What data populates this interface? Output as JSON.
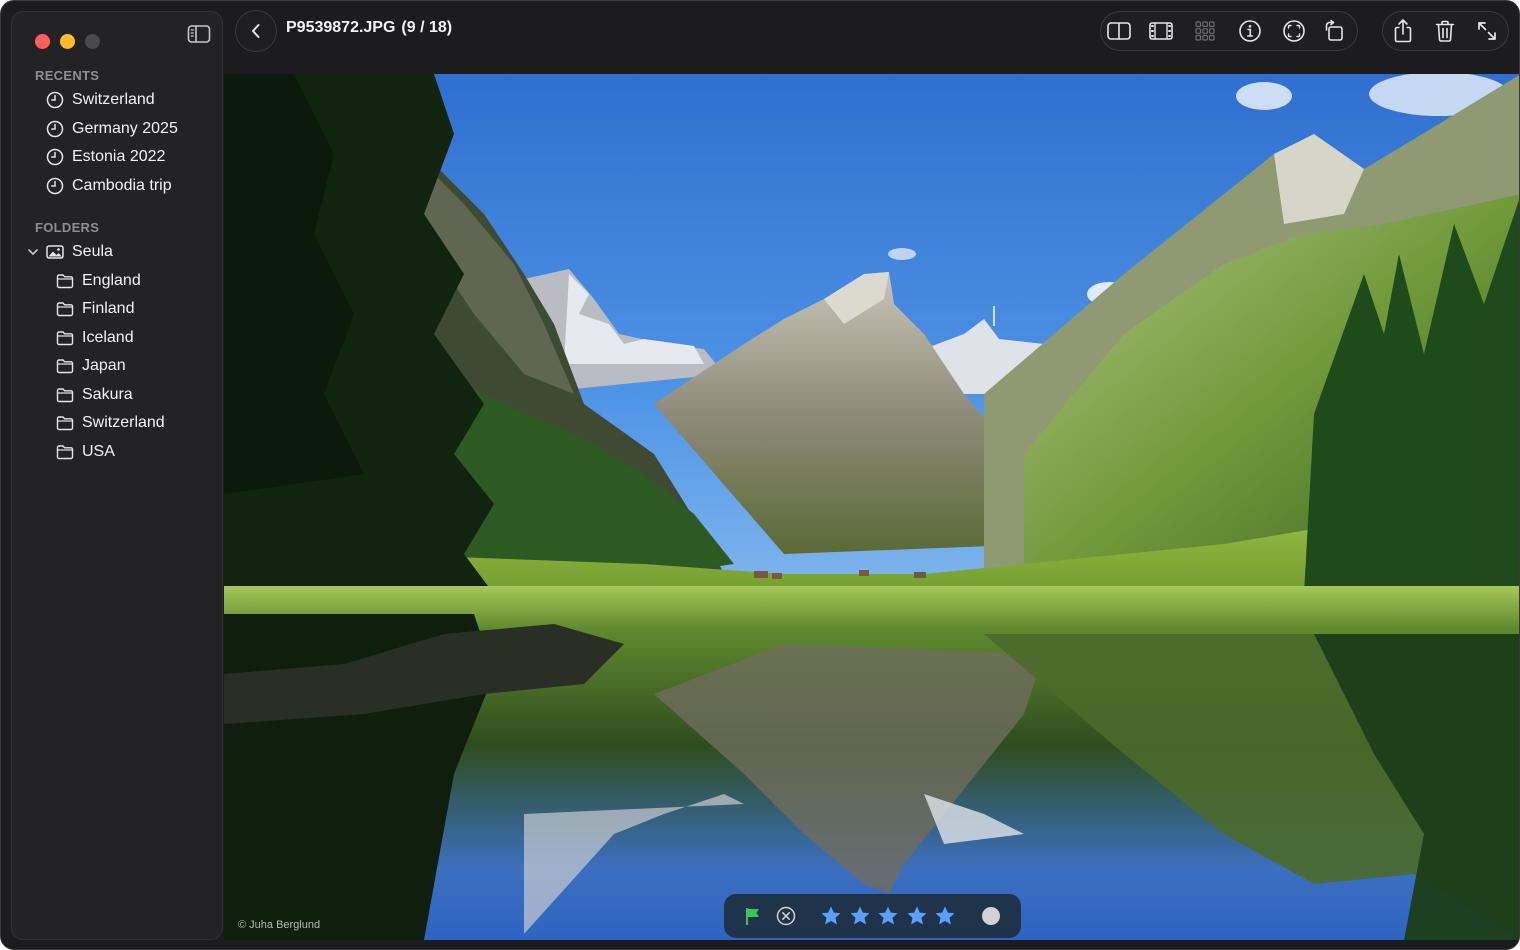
{
  "window": {
    "controls": [
      "close",
      "minimize",
      "zoom"
    ]
  },
  "sidebar": {
    "recents_title": "RECENTS",
    "recents": [
      {
        "label": "Switzerland",
        "icon": "clock-icon"
      },
      {
        "label": "Germany 2025",
        "icon": "clock-icon"
      },
      {
        "label": "Estonia 2022",
        "icon": "clock-icon"
      },
      {
        "label": "Cambodia trip",
        "icon": "clock-icon"
      }
    ],
    "folders_title": "FOLDERS",
    "root_folder": {
      "label": "Seula",
      "icon": "photo-icon",
      "expanded": true
    },
    "folders": [
      {
        "label": "England",
        "icon": "folder-icon"
      },
      {
        "label": "Finland",
        "icon": "folder-icon"
      },
      {
        "label": "Iceland",
        "icon": "folder-icon"
      },
      {
        "label": "Japan",
        "icon": "folder-icon"
      },
      {
        "label": "Sakura",
        "icon": "folder-icon"
      },
      {
        "label": "Switzerland",
        "icon": "folder-icon"
      },
      {
        "label": "USA",
        "icon": "folder-icon"
      }
    ]
  },
  "toolbar": {
    "filename": "P9539872.JPG",
    "position": "(9 / 18)",
    "view_icons": [
      "split-view-icon",
      "filmstrip-icon",
      "grid-icon",
      "info-icon",
      "face-detect-icon",
      "rotate-icon"
    ],
    "action_icons": [
      "share-icon",
      "trash-icon",
      "fullscreen-icon"
    ]
  },
  "photo": {
    "credit": "© Juha Berglund"
  },
  "rating": {
    "flag": "flagged",
    "stars": 5,
    "star_color": "#5aa0ff",
    "flag_color": "#34c759"
  }
}
